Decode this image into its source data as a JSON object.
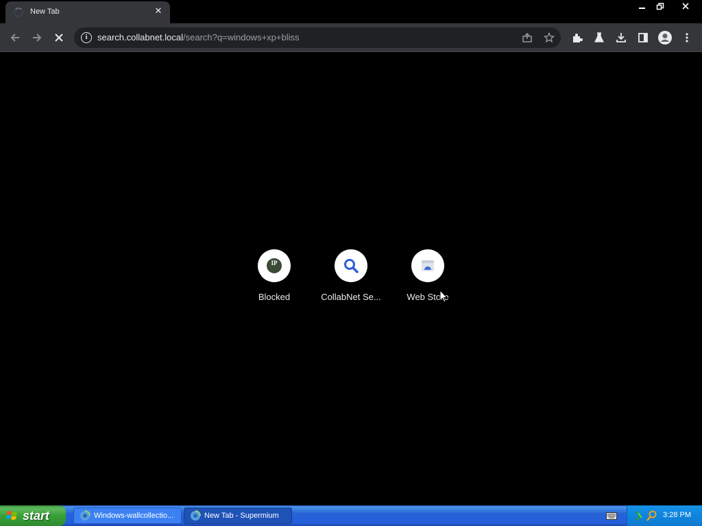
{
  "browser": {
    "tab": {
      "title": "New Tab",
      "close_icon": "close-icon"
    },
    "window_controls": [
      "minimize-icon",
      "restore-icon",
      "close-icon"
    ],
    "toolbar": {
      "url_host": "search.collabnet.local",
      "url_path": "/search?q=windows+xp+bliss",
      "icons": [
        "back-icon",
        "forward-icon",
        "stop-icon",
        "info-icon",
        "share-icon",
        "bookmark-star-icon",
        "extensions-icon",
        "labs-icon",
        "download-icon",
        "side-panel-icon",
        "profile-icon",
        "menu-icon"
      ]
    }
  },
  "shortcuts": [
    {
      "label": "Blocked",
      "icon": "ip-icon"
    },
    {
      "label": "CollabNet Se...",
      "icon": "search-icon"
    },
    {
      "label": "Web Store",
      "icon": "web-store-icon"
    }
  ],
  "taskbar": {
    "start_label": "start",
    "tasks": [
      {
        "label": "Windows-wallcollectio...",
        "active": false
      },
      {
        "label": "New Tab - Supermium",
        "active": true
      }
    ],
    "clock": "3:28 PM"
  },
  "colors": {
    "page_bg": "#000000",
    "toolbar_bg": "#35363a",
    "omnibox_bg": "#202124",
    "taskbar_blue": "#245edb",
    "start_green": "#37a137"
  }
}
